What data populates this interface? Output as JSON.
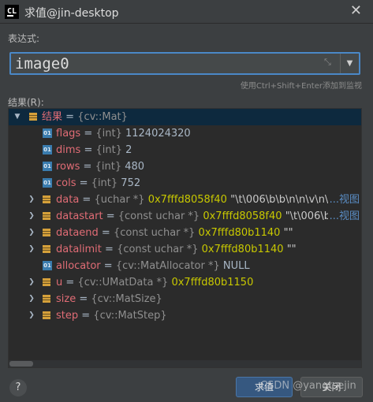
{
  "window": {
    "title": "求值@jin-desktop",
    "logo": "CL",
    "close_glyph": "✕"
  },
  "expression": {
    "label": "表达式:",
    "value": "image0",
    "expand_glyph": "⤡",
    "dropdown_glyph": "▼"
  },
  "hint": "使用Ctrl+Shift+Enter添加到监视",
  "result_label": "结果(R):",
  "tree": {
    "root": {
      "name": "结果",
      "eq": " = ",
      "type": "{cv::Mat}"
    },
    "rows": [
      {
        "name": "flags",
        "eq": " = ",
        "type": "{int} ",
        "value": "1124024320",
        "value_cls": "v",
        "icon": "01",
        "expandable": false
      },
      {
        "name": "dims",
        "eq": " = ",
        "type": "{int} ",
        "value": "2",
        "value_cls": "v",
        "icon": "01",
        "expandable": false
      },
      {
        "name": "rows",
        "eq": " = ",
        "type": "{int} ",
        "value": "480",
        "value_cls": "v",
        "icon": "01",
        "expandable": false
      },
      {
        "name": "cols",
        "eq": " = ",
        "type": "{int} ",
        "value": "752",
        "value_cls": "v",
        "icon": "01",
        "expandable": false
      },
      {
        "name": "data",
        "eq": " = ",
        "type": "{uchar *} ",
        "value": "0x7fffd8058f40",
        "value_cls": "a",
        "extra": " \"\\t\\006\\b\\b\\n\\n\\v\\n\\f\\f",
        "link": "...视图",
        "expandable": true
      },
      {
        "name": "datastart",
        "eq": " = ",
        "type": "{const uchar *} ",
        "value": "0x7fffd8058f40",
        "value_cls": "a",
        "extra": " \"\\t\\006\\b",
        "link": "...视图",
        "expandable": true
      },
      {
        "name": "dataend",
        "eq": " = ",
        "type": "{const uchar *} ",
        "value": "0x7fffd80b1140",
        "value_cls": "a",
        "extra": " \"\"",
        "link": "",
        "expandable": true
      },
      {
        "name": "datalimit",
        "eq": " = ",
        "type": "{const uchar *} ",
        "value": "0x7fffd80b1140",
        "value_cls": "a",
        "extra": " \"\"",
        "link": "",
        "expandable": true
      },
      {
        "name": "allocator",
        "eq": " = ",
        "type": "{cv::MatAllocator *} ",
        "value": "NULL",
        "value_cls": "v",
        "icon": "01",
        "expandable": false
      },
      {
        "name": "u",
        "eq": " = ",
        "type": "{cv::UMatData *} ",
        "value": "0x7fffd80b1150",
        "value_cls": "a",
        "expandable": true
      },
      {
        "name": "size",
        "eq": " = ",
        "type": "{cv::MatSize}",
        "value": "",
        "value_cls": "v",
        "expandable": true
      },
      {
        "name": "step",
        "eq": " = ",
        "type": "{cv::MatStep}",
        "value": "",
        "value_cls": "v",
        "expandable": true
      }
    ]
  },
  "buttons": {
    "help": "?",
    "evaluate": "求值",
    "close": "关闭"
  },
  "watermark": "CSDN @yangtsejin"
}
